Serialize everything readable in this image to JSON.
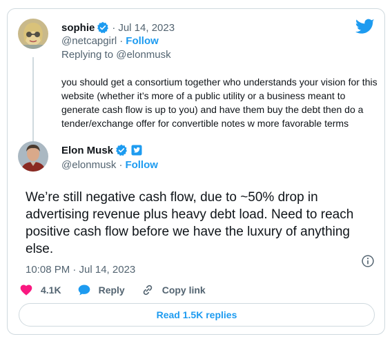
{
  "colors": {
    "accent": "#1d9bf0",
    "text": "#0f1419",
    "muted": "#536471",
    "heart": "#f91880",
    "border": "#cfd9de"
  },
  "reply_tweet": {
    "author_name": "sophie",
    "date": "Jul 14, 2023",
    "handle": "@netcapgirl",
    "follow_label": "Follow",
    "replying_to": "Replying to @elonmusk",
    "text": "you should get a consortium together who understands your vision for this website (whether it’s more of a public utility or a business meant to generate cash flow is up to you) and have them buy the debt then do a tender/exchange offer for convertible notes w more favorable terms"
  },
  "main_tweet": {
    "author_name": "Elon Musk",
    "handle": "@elonmusk",
    "follow_label": "Follow",
    "text": "We’re still negative cash flow, due to ~50% drop in advertising revenue plus heavy debt load. Need to reach positive cash flow before we have the luxury of anything else.",
    "timestamp": "10:08 PM · Jul 14, 2023"
  },
  "actions": {
    "likes": "4.1K",
    "reply_label": "Reply",
    "copy_link_label": "Copy link"
  },
  "read_replies_label": "Read 1.5K replies",
  "icons": [
    "twitter-logo",
    "verified-badge",
    "affiliation-badge",
    "info-icon",
    "heart-icon",
    "reply-icon",
    "link-icon"
  ]
}
